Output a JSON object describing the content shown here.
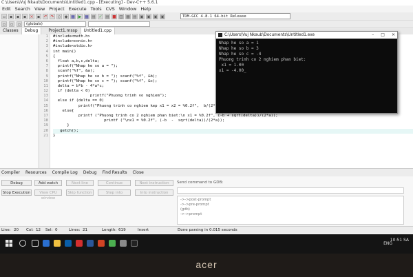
{
  "window": {
    "title": "C:\\Users\\Vuj Nkaub\\Documents\\Untitled1.cpp - [Executing] - Dev-C++ 5.6.1"
  },
  "menu": [
    "Edit",
    "Search",
    "View",
    "Project",
    "Execute",
    "Tools",
    "CVS",
    "Window",
    "Help"
  ],
  "toolbar": {
    "compiler": "TDM-GCC 4.8.1 64-bit Release",
    "globals_combo": "(globals)"
  },
  "left_tabs": [
    "Classes",
    "Debug"
  ],
  "file_tabs": [
    "Project1.mssp",
    "Untitled1.cpp"
  ],
  "code_lines": [
    "#include<math.h>",
    "#include<conio.h>",
    "#include<stdio.h>",
    "int main()",
    "{",
    "  float a,b,c,delta;",
    "  printf(\"Nhap he so a = \");",
    "  scanf(\"%f\", &a);",
    "  printf(\"Nhap he so b = \"); scanf(\"%f\", &b);",
    "  printf(\"Nhap he so c = \"); scanf(\"%f\", &c);",
    "  delta = b*b - 4*a*c;",
    "  if (delta < 0)",
    "                printf(\"Phuong trinh vo nghiem\");",
    "  else if (delta == 0)",
    "           printf(\"Phuong trinh co nghiem kep x1 = x2 = %0.2f\",  b/(2*a));",
    "    else{",
    "           printf (\"Phuong trinh co 2 nghiem phan biet:\\n x1 = %0.2f\", (-b + sqrt(delta))/(2*a));",
    "                      printf (\"\\nx1 = %0.2f\", (-b  -  sqrt(delta))/(2*a));",
    "      }",
    "   getch();",
    "}"
  ],
  "console": {
    "title": "C:\\Users\\Vuj Nkaub\\Documents\\Untitled1.exe",
    "lines": [
      "Nhap he so a = 1",
      "Nhap he so b = 3",
      "Nhap he so c = -4",
      "Phuong trinh co 2 nghiem phan biet:",
      " x1 = 1.00",
      "x1 = -4.00_"
    ]
  },
  "bottom_tabs": [
    "Compiler",
    "Resources",
    "Compile Log",
    "Debug",
    "Find Results",
    "Close"
  ],
  "debug_buttons": {
    "debug": "Debug",
    "add_watch": "Add watch",
    "next_line": "Next line",
    "continue": "Continue",
    "next_instruction": "Next instruction",
    "stop_execution": "Stop Execution",
    "view_cpu": "View CPU window",
    "skip_function": "Skip function",
    "step_into": "Step into",
    "into_instruction": "Into instruction"
  },
  "gdb": {
    "label": "Send command to GDB:",
    "output": [
      "->->post-prompt",
      "->->pre-prompt",
      "(gdb)",
      "->->prompt"
    ]
  },
  "status": {
    "line": "Line:",
    "line_val": "20",
    "col": "Col:",
    "col_val": "12",
    "sel": "Sel:",
    "sel_val": "0",
    "lines": "Lines:",
    "lines_val": "21",
    "length": "Length:",
    "length_val": "619",
    "mode": "Insert",
    "message": "Done parsing in 0.015 seconds"
  },
  "taskbar": {
    "lang": "ENG",
    "time": "10:51 SA"
  },
  "brand": "acer"
}
